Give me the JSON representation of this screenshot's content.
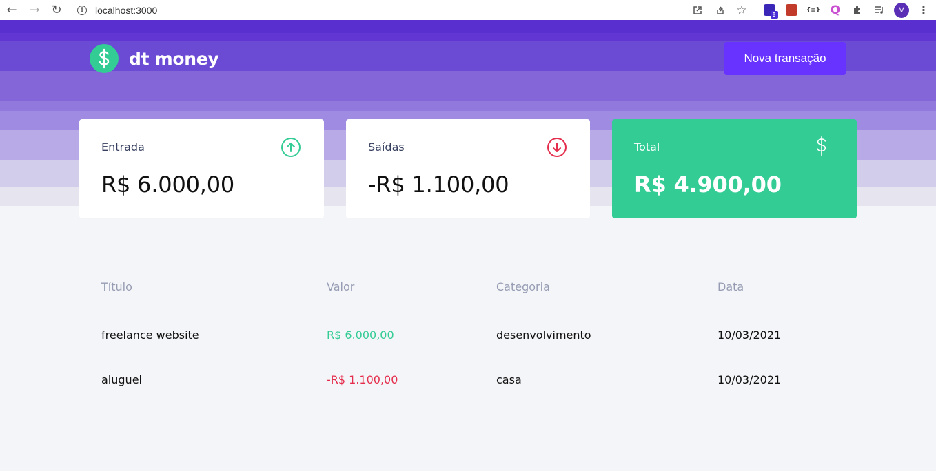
{
  "browser": {
    "url": "localhost:3000",
    "extension_badge": "8",
    "profile_initial": "V",
    "ext_json_label": "{≡}"
  },
  "app": {
    "name": "dt money",
    "new_transaction_label": "Nova transação",
    "colors": {
      "brand_purple": "#5429cc",
      "button_purple": "#6933ff",
      "green": "#33cc95",
      "red": "#e52e4d",
      "background": "#f4f5f8"
    }
  },
  "summary": {
    "income": {
      "label": "Entrada",
      "value": "R$ 6.000,00",
      "icon": "arrow-up-circle-icon"
    },
    "outcome": {
      "label": "Saídas",
      "value": "-R$ 1.100,00",
      "icon": "arrow-down-circle-icon"
    },
    "total": {
      "label": "Total",
      "value": "R$ 4.900,00",
      "icon": "dollar-sign-icon"
    }
  },
  "table": {
    "headers": [
      "Título",
      "Valor",
      "Categoria",
      "Data"
    ],
    "rows": [
      {
        "title": "freelance website",
        "amount": "R$ 6.000,00",
        "type": "deposit",
        "category": "desenvolvimento",
        "date": "10/03/2021"
      },
      {
        "title": "aluguel",
        "amount": "-R$ 1.100,00",
        "type": "withdraw",
        "category": "casa",
        "date": "10/03/2021"
      }
    ]
  }
}
